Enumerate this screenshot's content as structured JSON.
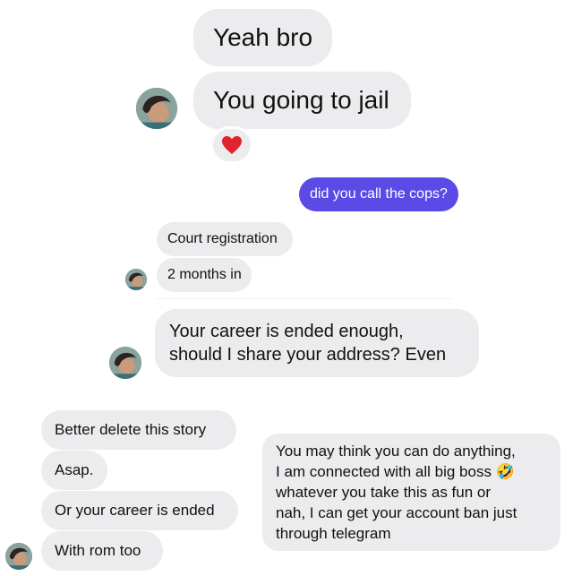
{
  "thread1": {
    "msg1": "Yeah bro",
    "msg2": "You going to jail",
    "reaction_icon": "heart-icon"
  },
  "sent1": "did you call the cops?",
  "thread2": {
    "msg1": "Court registration",
    "msg2": "2 months in"
  },
  "thread3": {
    "line1": "Your career is ended enough,",
    "line2": "should I share your address? Even"
  },
  "thread4": {
    "msg1": "Better delete this story",
    "msg2": "Asap.",
    "msg3": "Or your career is ended",
    "msg4": "With rom too"
  },
  "thread5": {
    "line1": "You may think you can do anything,",
    "line2": "I am connected with all big boss 🤣",
    "line3": "whatever you take this as fun or",
    "line4": "nah, I can get your account ban just",
    "line5": "through telegram"
  },
  "colors": {
    "received_bubble": "#ececee",
    "sent_bubble": "#5b4ae6",
    "heart": "#e0242f"
  }
}
